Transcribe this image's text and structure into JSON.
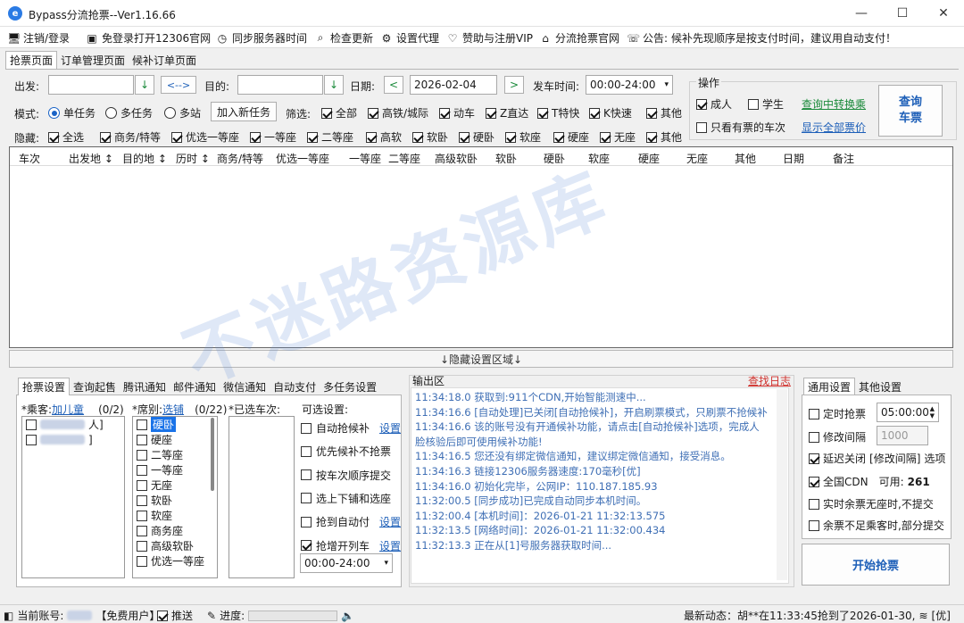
{
  "window": {
    "title": "Bypass分流抢票--Ver1.16.66"
  },
  "menu": [
    {
      "icon": "monitor-icon",
      "glyph": "🖥",
      "label": "注销/登录"
    },
    {
      "icon": "screen-icon",
      "glyph": "▣",
      "label": "免登录打开12306官网"
    },
    {
      "icon": "clock-icon",
      "glyph": "◷",
      "label": "同步服务器时间"
    },
    {
      "icon": "search-icon",
      "glyph": "⌕",
      "label": "检查更新"
    },
    {
      "icon": "gear-icon",
      "glyph": "⚙",
      "label": "设置代理"
    },
    {
      "icon": "heart-icon",
      "glyph": "♡",
      "label": "赞助与注册VIP"
    },
    {
      "icon": "home-icon",
      "glyph": "⌂",
      "label": "分流抢票官网"
    },
    {
      "icon": "speaker-icon",
      "glyph": "☏",
      "label": "公告:"
    }
  ],
  "announcement": "候补先现顺序是按支付时间，建议用自动支付！",
  "top_tabs": [
    "抢票页面",
    "订单管理页面",
    "候补订单页面"
  ],
  "query": {
    "from_label": "出发:",
    "from_value": "",
    "swap_label": "<-->",
    "to_label": "目的:",
    "to_value": "",
    "date_label": "日期:",
    "date_value": "2026-02-04",
    "prev": "<",
    "next": ">",
    "time_label": "发车时间:",
    "time_value": "00:00-24:00"
  },
  "mode": {
    "label": "模式:",
    "options": [
      {
        "label": "单任务",
        "checked": true
      },
      {
        "label": "多任务",
        "checked": false
      },
      {
        "label": "多站",
        "checked": false
      }
    ],
    "add_task": "加入新任务"
  },
  "filter": {
    "label": "筛选:",
    "items": [
      {
        "label": "全部",
        "checked": true
      },
      {
        "label": "高铁/城际",
        "checked": true
      },
      {
        "label": "动车",
        "checked": true
      },
      {
        "label": "Z直达",
        "checked": true
      },
      {
        "label": "T特快",
        "checked": true
      },
      {
        "label": "K快速",
        "checked": true
      },
      {
        "label": "其他",
        "checked": true
      }
    ]
  },
  "hide": {
    "label": "隐藏:",
    "items": [
      {
        "label": "全选",
        "checked": true
      },
      {
        "label": "商务/特等",
        "checked": true
      },
      {
        "label": "优选一等座",
        "checked": true
      },
      {
        "label": "一等座",
        "checked": true
      },
      {
        "label": "二等座",
        "checked": true
      },
      {
        "label": "高软",
        "checked": true
      },
      {
        "label": "软卧",
        "checked": true
      },
      {
        "label": "硬卧",
        "checked": true
      },
      {
        "label": "软座",
        "checked": true
      },
      {
        "label": "硬座",
        "checked": true
      },
      {
        "label": "无座",
        "checked": true
      },
      {
        "label": "其他",
        "checked": true
      }
    ]
  },
  "ops": {
    "title": "操作",
    "adult": {
      "label": "成人",
      "checked": true
    },
    "student": {
      "label": "学生",
      "checked": false
    },
    "transfer_link": "查询中转换乘",
    "only_available": {
      "label": "只看有票的车次",
      "checked": false
    },
    "show_all_prices": "显示全部票价",
    "query_btn": "查询\n车票"
  },
  "grid": {
    "columns": [
      "车次",
      "出发地 ↕",
      "目的地 ↕",
      "历时 ↕",
      "商务/特等",
      "优选一等座",
      "一等座",
      "二等座",
      "高级软卧",
      "软卧",
      "硬卧",
      "软座",
      "硬座",
      "无座",
      "其他",
      "日期",
      "备注"
    ]
  },
  "hide_settings": "↓隐藏设置区域↓",
  "bottom_tabs": [
    "抢票设置",
    "查询起售",
    "腾讯通知",
    "邮件通知",
    "微信通知",
    "自动支付",
    "多任务设置"
  ],
  "passenger": {
    "label": "*乘客:",
    "link": "加儿童",
    "count": "(0/2)",
    "items": [
      {
        "checked": false,
        "suffix": "人]"
      },
      {
        "checked": false,
        "suffix": "]"
      }
    ]
  },
  "seat": {
    "label": "*席别:",
    "link": "选铺",
    "count": "(0/22)",
    "items": [
      "硬卧",
      "硬座",
      "二等座",
      "一等座",
      "无座",
      "软卧",
      "软座",
      "商务座",
      "高级软卧",
      "优选一等座"
    ]
  },
  "selected_trains_label": "*已选车次:",
  "optional": {
    "label": "可选设置:",
    "items": [
      {
        "label": "自动抢候补",
        "checked": false,
        "link": "设置"
      },
      {
        "label": "优先候补不抢票",
        "checked": false,
        "link": ""
      },
      {
        "label": "按车次顺序提交",
        "checked": false,
        "link": ""
      },
      {
        "label": "选上下铺和选座",
        "checked": false,
        "link": ""
      },
      {
        "label": "抢到自动付",
        "checked": false,
        "link": "设置"
      },
      {
        "label": "抢增开列车",
        "checked": true,
        "link": "设置"
      }
    ],
    "time_value": "00:00-24:00"
  },
  "log": {
    "title": "输出区",
    "find_log": "查找日志",
    "lines": [
      "11:34:18.0  获取到:911个CDN,开始智能测速中...",
      "11:34:16.6  [自动处理]已关闭[自动抢候补]，开启刷票模式，只刷票不抢候补",
      "11:34:16.6  该的账号没有开通候补功能，请点击[自动抢候补]选项，完成人",
      "脸核验后即可使用候补功能!",
      "11:34:16.5  您还没有绑定微信通知，建议绑定微信通知，接受消息。",
      "11:34:16.3  链接12306服务器速度:170毫秒[优]",
      "11:34:16.0  初始化完毕，公网IP：110.187.185.93",
      "11:32:00.5  [同步成功]已完成自动同步本机时间。",
      "11:32:00.4  [本机时间]：2026-01-21 11:32:13.575",
      "11:32:13.5  [网络时间]：2026-01-21 11:32:00.434",
      "11:32:13.3  正在从[1]号服务器获取时间..."
    ]
  },
  "general": {
    "tabs": [
      "通用设置",
      "其他设置"
    ],
    "timed": {
      "label": "定时抢票",
      "checked": false,
      "value": "05:00:00"
    },
    "interval": {
      "label": "修改间隔",
      "checked": false,
      "value": "1000"
    },
    "delay_close": {
      "label": "延迟关闭",
      "checked": true,
      "link_text": "[修改间隔]",
      "suffix": "选项"
    },
    "cdn": {
      "label": "全国CDN",
      "checked": true,
      "available_label": "可用:",
      "available": "261"
    },
    "realtime": {
      "label": "实时余票无座时,不提交",
      "checked": false
    },
    "partial": {
      "label": "余票不足乘客时,部分提交",
      "checked": false
    },
    "start_btn": "开始抢票"
  },
  "status": {
    "account_label": "当前账号:",
    "user_type": "【免费用户】",
    "push": "推送",
    "progress": "进度:",
    "latest": "最新动态：胡**在11:33:45抢到了2026-01-30,",
    "badge": "[优]"
  },
  "watermark": "不迷路资源库"
}
